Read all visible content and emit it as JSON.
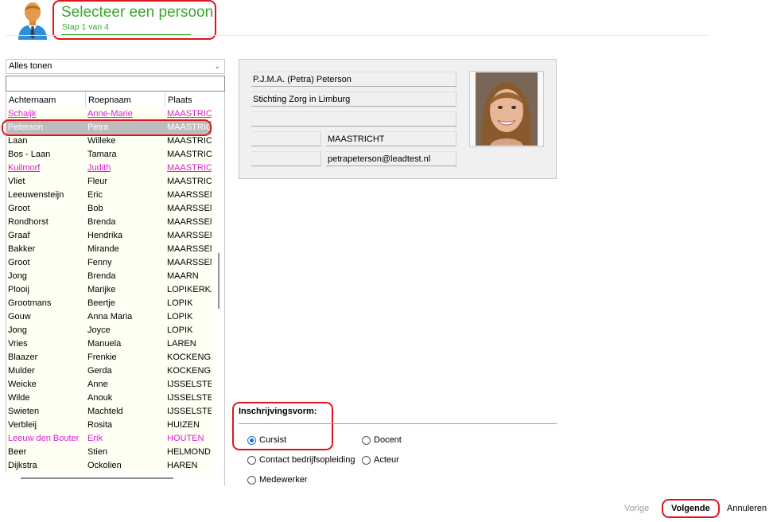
{
  "header": {
    "title": "Selecteer een persoon",
    "step": "Stap 1 van 4"
  },
  "filter": {
    "selected": "Alles tonen"
  },
  "search": {
    "value": "",
    "placeholder": ""
  },
  "table": {
    "columns": [
      "Achternaam",
      "Roepnaam",
      "Plaats"
    ],
    "rows": [
      {
        "achternaam": "Schaijk",
        "roepnaam": "Anne-Marie",
        "plaats": "MAASTRICHT",
        "style": "magenta-underline"
      },
      {
        "achternaam": "Peterson",
        "roepnaam": "Petra",
        "plaats": "MAASTRICHT",
        "style": "selected"
      },
      {
        "achternaam": "Laan",
        "roepnaam": "Willeke",
        "plaats": "MAASTRICHT",
        "style": "normal"
      },
      {
        "achternaam": "Bos - Laan",
        "roepnaam": "Tamara",
        "plaats": "MAASTRICHT",
        "style": "normal"
      },
      {
        "achternaam": "Kuilmorf",
        "roepnaam": "Judith",
        "plaats": "MAASTRICHT",
        "style": "magenta-underline"
      },
      {
        "achternaam": "Vliet",
        "roepnaam": "Fleur",
        "plaats": "MAASTRICHT",
        "style": "normal"
      },
      {
        "achternaam": "Leeuwensteijn",
        "roepnaam": "Eric",
        "plaats": "MAARSSENBROEK",
        "style": "normal"
      },
      {
        "achternaam": "Groot",
        "roepnaam": "Bob",
        "plaats": "MAARSSENBROEK",
        "style": "normal"
      },
      {
        "achternaam": "Rondhorst",
        "roepnaam": "Brenda",
        "plaats": "MAARSSENBROEK",
        "style": "normal"
      },
      {
        "achternaam": "Graaf",
        "roepnaam": "Hendrika",
        "plaats": "MAARSSENBROEK",
        "style": "normal"
      },
      {
        "achternaam": "Bakker",
        "roepnaam": "Mirande",
        "plaats": "MAARSSEN",
        "style": "normal"
      },
      {
        "achternaam": "Groot",
        "roepnaam": "Fenny",
        "plaats": "MAARSSEN",
        "style": "normal"
      },
      {
        "achternaam": "Jong",
        "roepnaam": "Brenda",
        "plaats": "MAARN",
        "style": "normal"
      },
      {
        "achternaam": "Plooij",
        "roepnaam": "Marijke",
        "plaats": "LOPIKERKAPEL",
        "style": "normal"
      },
      {
        "achternaam": "Grootmans",
        "roepnaam": "Beertje",
        "plaats": "LOPIK",
        "style": "normal"
      },
      {
        "achternaam": "Gouw",
        "roepnaam": "Anna Maria",
        "plaats": "LOPIK",
        "style": "normal"
      },
      {
        "achternaam": "Jong",
        "roepnaam": "Joyce",
        "plaats": "LOPIK",
        "style": "normal"
      },
      {
        "achternaam": "Vries",
        "roepnaam": "Manuela",
        "plaats": "LAREN",
        "style": "normal"
      },
      {
        "achternaam": "Blaazer",
        "roepnaam": "Frenkie",
        "plaats": "KOCKENGEN",
        "style": "normal"
      },
      {
        "achternaam": "Mulder",
        "roepnaam": "Gerda",
        "plaats": "KOCKENGEN",
        "style": "normal"
      },
      {
        "achternaam": "Weicke",
        "roepnaam": "Anne",
        "plaats": "IJSSELSTEIN",
        "style": "normal"
      },
      {
        "achternaam": "Wilde",
        "roepnaam": "Anouk",
        "plaats": "IJSSELSTEIN",
        "style": "normal"
      },
      {
        "achternaam": "Swieten",
        "roepnaam": "Machteld",
        "plaats": "IJSSELSTEIN",
        "style": "normal"
      },
      {
        "achternaam": "Verbleij",
        "roepnaam": "Rosita",
        "plaats": "HUIZEN",
        "style": "normal"
      },
      {
        "achternaam": "Leeuw den Bouter",
        "roepnaam": "Erik",
        "plaats": "HOUTEN",
        "style": "magenta"
      },
      {
        "achternaam": "Beer",
        "roepnaam": "Stien",
        "plaats": "HELMOND",
        "style": "normal"
      },
      {
        "achternaam": "Dijkstra",
        "roepnaam": "Ockolien",
        "plaats": "HAREN",
        "style": "normal"
      }
    ]
  },
  "person": {
    "name": "P.J.M.A. (Petra) Peterson",
    "organisation": "Stichting Zorg in Limburg",
    "address": "",
    "postcode": "",
    "city": "MAASTRICHT",
    "phone": "",
    "email": "petrapeterson@leadtest.nl"
  },
  "registration": {
    "title": "Inschrijvingsvorm:",
    "options": [
      {
        "label": "Cursist",
        "checked": true
      },
      {
        "label": "Docent",
        "checked": false
      },
      {
        "label": "Contact bedrijfsopleiding",
        "checked": false
      },
      {
        "label": "Acteur",
        "checked": false
      },
      {
        "label": "Medewerker",
        "checked": false
      }
    ]
  },
  "footer": {
    "prev_label": "Vorige",
    "next_label": "Volgende",
    "cancel_label": "Annuleren"
  },
  "colors": {
    "accent_green": "#3aa62e",
    "highlight_red": "#e0151c",
    "link_magenta": "#d41fd4",
    "radio_blue": "#1a6fc9"
  }
}
